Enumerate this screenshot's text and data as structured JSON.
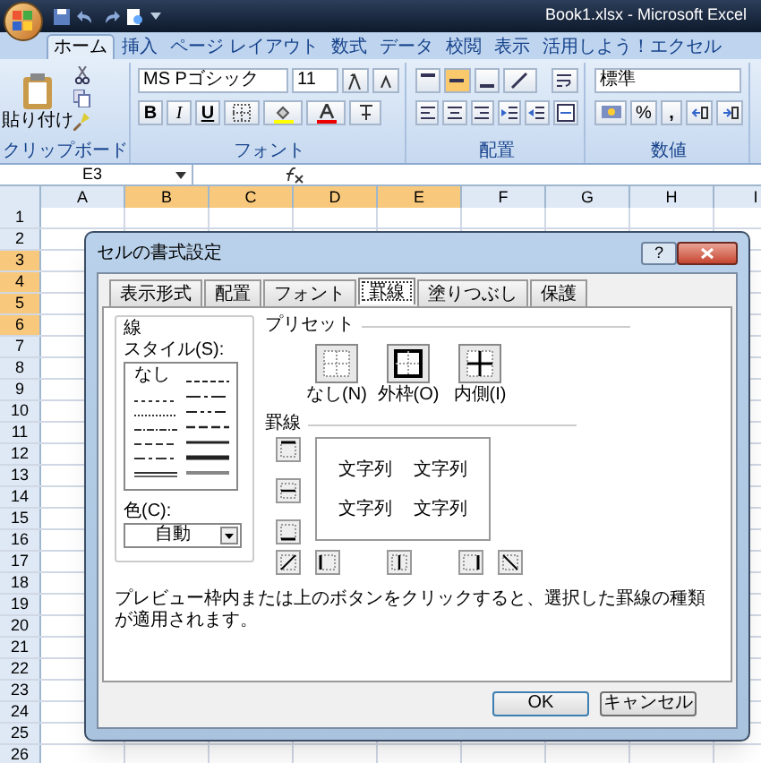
{
  "window": {
    "title": "Book1.xlsx - Microsoft Excel"
  },
  "ribbon_tabs": [
    {
      "label": "ホーム",
      "selected": true
    },
    {
      "label": "挿入",
      "selected": false
    },
    {
      "label": "ページ レイアウト",
      "selected": false
    },
    {
      "label": "数式",
      "selected": false
    },
    {
      "label": "データ",
      "selected": false
    },
    {
      "label": "校閲",
      "selected": false
    },
    {
      "label": "表示",
      "selected": false
    },
    {
      "label": "活用しよう！エクセル",
      "selected": false
    }
  ],
  "ribbon": {
    "clipboard": {
      "paste": "貼り付け",
      "label": "クリップボード"
    },
    "font": {
      "name": "MS Pゴシック",
      "size": "11",
      "bold": "B",
      "italic": "I",
      "underline": "U",
      "label": "フォント"
    },
    "alignment": {
      "label": "配置"
    },
    "number": {
      "format": "標準",
      "percent": "%",
      "comma": ",",
      "label": "数値"
    }
  },
  "formula_bar": {
    "name_box": "E3"
  },
  "sheet": {
    "columns": [
      {
        "label": "A",
        "selected": false
      },
      {
        "label": "B",
        "selected": true
      },
      {
        "label": "C",
        "selected": true
      },
      {
        "label": "D",
        "selected": true
      },
      {
        "label": "E",
        "selected": true
      },
      {
        "label": "F",
        "selected": false
      },
      {
        "label": "G",
        "selected": false
      },
      {
        "label": "H",
        "selected": false
      },
      {
        "label": "I",
        "selected": false
      }
    ],
    "rows": [
      {
        "label": "1",
        "selected": false
      },
      {
        "label": "2",
        "selected": false
      },
      {
        "label": "3",
        "selected": true
      },
      {
        "label": "4",
        "selected": true
      },
      {
        "label": "5",
        "selected": true
      },
      {
        "label": "6",
        "selected": true
      },
      {
        "label": "7",
        "selected": false
      },
      {
        "label": "8",
        "selected": false
      },
      {
        "label": "9",
        "selected": false
      },
      {
        "label": "10",
        "selected": false
      },
      {
        "label": "11",
        "selected": false
      },
      {
        "label": "12",
        "selected": false
      },
      {
        "label": "13",
        "selected": false
      },
      {
        "label": "14",
        "selected": false
      },
      {
        "label": "15",
        "selected": false
      },
      {
        "label": "16",
        "selected": false
      },
      {
        "label": "17",
        "selected": false
      },
      {
        "label": "18",
        "selected": false
      },
      {
        "label": "19",
        "selected": false
      },
      {
        "label": "20",
        "selected": false
      },
      {
        "label": "21",
        "selected": false
      },
      {
        "label": "22",
        "selected": false
      },
      {
        "label": "23",
        "selected": false
      },
      {
        "label": "24",
        "selected": false
      },
      {
        "label": "25",
        "selected": false
      },
      {
        "label": "26",
        "selected": false
      }
    ]
  },
  "dialog": {
    "title": "セルの書式設定",
    "help": "?",
    "tabs": [
      {
        "label": "表示形式",
        "selected": false
      },
      {
        "label": "配置",
        "selected": false
      },
      {
        "label": "フォント",
        "selected": false
      },
      {
        "label": "罫線",
        "selected": true
      },
      {
        "label": "塗りつぶし",
        "selected": false
      },
      {
        "label": "保護",
        "selected": false
      }
    ],
    "line": {
      "label": "線",
      "style_label": "スタイル(S):",
      "none_style": "なし",
      "color_label": "色(C):",
      "color_value": "自動"
    },
    "presets": {
      "label": "プリセット",
      "items": [
        "なし(N)",
        "外枠(O)",
        "内側(I)"
      ]
    },
    "border": {
      "label": "罫線",
      "preview_texts": [
        "文字列",
        "文字列",
        "文字列",
        "文字列"
      ]
    },
    "note": "プレビュー枠内または上のボタンをクリックすると、選択した罫線の種類が適用されます。",
    "buttons": [
      "OK",
      "キャンセル"
    ]
  }
}
